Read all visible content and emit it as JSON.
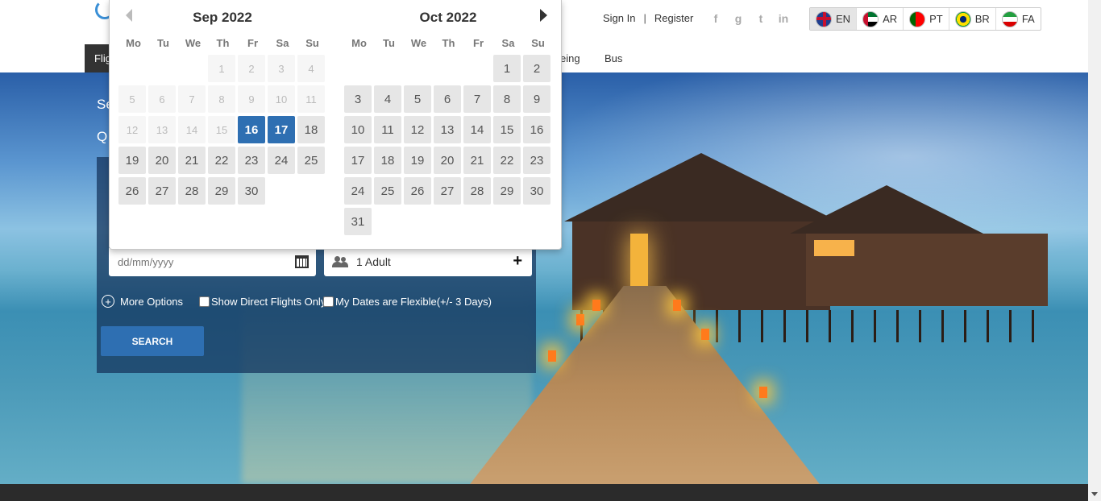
{
  "header": {
    "sign_in": "Sign In",
    "separator": "|",
    "register": "Register",
    "social": [
      "f",
      "g",
      "t",
      "in"
    ],
    "languages": [
      {
        "code": "EN",
        "flag": "en",
        "active": true
      },
      {
        "code": "AR",
        "flag": "ar",
        "active": false
      },
      {
        "code": "PT",
        "flag": "pt",
        "active": false
      },
      {
        "code": "BR",
        "flag": "br",
        "active": false
      },
      {
        "code": "FA",
        "flag": "fa",
        "active": false
      }
    ]
  },
  "nav": {
    "active_label": "Flig",
    "items": [
      "eing",
      "Bus"
    ]
  },
  "hero": {
    "line1": "Se",
    "line2": "Q"
  },
  "datepicker": {
    "months": [
      {
        "title": "Sep 2022",
        "weekdays": [
          "Mo",
          "Tu",
          "We",
          "Th",
          "Fr",
          "Sa",
          "Su"
        ],
        "cells": [
          {
            "d": "",
            "s": "empty"
          },
          {
            "d": "",
            "s": "empty"
          },
          {
            "d": "",
            "s": "empty"
          },
          {
            "d": "1",
            "s": "disabled"
          },
          {
            "d": "2",
            "s": "disabled"
          },
          {
            "d": "3",
            "s": "disabled"
          },
          {
            "d": "4",
            "s": "disabled"
          },
          {
            "d": "5",
            "s": "disabled"
          },
          {
            "d": "6",
            "s": "disabled"
          },
          {
            "d": "7",
            "s": "disabled"
          },
          {
            "d": "8",
            "s": "disabled"
          },
          {
            "d": "9",
            "s": "disabled"
          },
          {
            "d": "10",
            "s": "disabled"
          },
          {
            "d": "11",
            "s": "disabled"
          },
          {
            "d": "12",
            "s": "disabled"
          },
          {
            "d": "13",
            "s": "disabled"
          },
          {
            "d": "14",
            "s": "disabled"
          },
          {
            "d": "15",
            "s": "disabled"
          },
          {
            "d": "16",
            "s": "selected"
          },
          {
            "d": "17",
            "s": "selected"
          },
          {
            "d": "18",
            "s": "other"
          },
          {
            "d": "19",
            "s": "other"
          },
          {
            "d": "20",
            "s": "other"
          },
          {
            "d": "21",
            "s": "other"
          },
          {
            "d": "22",
            "s": "other"
          },
          {
            "d": "23",
            "s": "other"
          },
          {
            "d": "24",
            "s": "other"
          },
          {
            "d": "25",
            "s": "other"
          },
          {
            "d": "26",
            "s": "other"
          },
          {
            "d": "27",
            "s": "other"
          },
          {
            "d": "28",
            "s": "other"
          },
          {
            "d": "29",
            "s": "other"
          },
          {
            "d": "30",
            "s": "other"
          }
        ]
      },
      {
        "title": "Oct 2022",
        "weekdays": [
          "Mo",
          "Tu",
          "We",
          "Th",
          "Fr",
          "Sa",
          "Su"
        ],
        "cells": [
          {
            "d": "",
            "s": "empty"
          },
          {
            "d": "",
            "s": "empty"
          },
          {
            "d": "",
            "s": "empty"
          },
          {
            "d": "",
            "s": "empty"
          },
          {
            "d": "",
            "s": "empty"
          },
          {
            "d": "1",
            "s": "other"
          },
          {
            "d": "2",
            "s": "other"
          },
          {
            "d": "3",
            "s": "other"
          },
          {
            "d": "4",
            "s": "other"
          },
          {
            "d": "5",
            "s": "other"
          },
          {
            "d": "6",
            "s": "other"
          },
          {
            "d": "7",
            "s": "other"
          },
          {
            "d": "8",
            "s": "other"
          },
          {
            "d": "9",
            "s": "other"
          },
          {
            "d": "10",
            "s": "other"
          },
          {
            "d": "11",
            "s": "other"
          },
          {
            "d": "12",
            "s": "other"
          },
          {
            "d": "13",
            "s": "other"
          },
          {
            "d": "14",
            "s": "other"
          },
          {
            "d": "15",
            "s": "other"
          },
          {
            "d": "16",
            "s": "other"
          },
          {
            "d": "17",
            "s": "other"
          },
          {
            "d": "18",
            "s": "other"
          },
          {
            "d": "19",
            "s": "other"
          },
          {
            "d": "20",
            "s": "other"
          },
          {
            "d": "21",
            "s": "other"
          },
          {
            "d": "22",
            "s": "other"
          },
          {
            "d": "23",
            "s": "other"
          },
          {
            "d": "24",
            "s": "other"
          },
          {
            "d": "25",
            "s": "other"
          },
          {
            "d": "26",
            "s": "other"
          },
          {
            "d": "27",
            "s": "other"
          },
          {
            "d": "28",
            "s": "other"
          },
          {
            "d": "29",
            "s": "other"
          },
          {
            "d": "30",
            "s": "other"
          },
          {
            "d": "31",
            "s": "other"
          }
        ]
      }
    ]
  },
  "search_form": {
    "date_placeholder": "dd/mm/yyyy",
    "passengers": "1 Adult",
    "passengers_plus": "+",
    "more_options": "More Options",
    "direct_flights": "Show Direct Flights Only",
    "flexible_dates": "My Dates are Flexible(+/- 3 Days)",
    "search_button": "SEARCH"
  },
  "colors": {
    "accent": "#2e6fb2",
    "nav_active": "#333333",
    "footer": "#2b2b2b"
  }
}
